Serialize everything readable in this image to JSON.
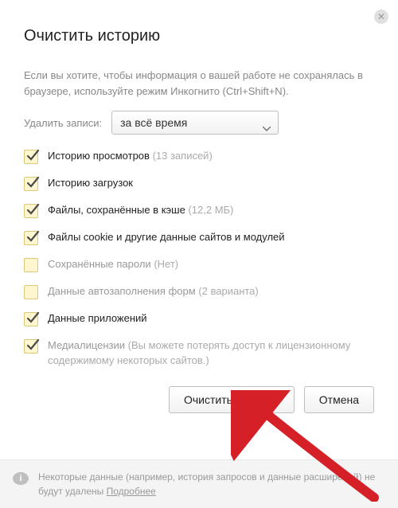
{
  "title": "Очистить историю",
  "hint_text": "Если вы хотите, чтобы информация о вашей работе не сохранялась в браузере, используйте режим Инкогнито (Ctrl+Shift+N).",
  "time_label": "Удалить записи:",
  "time_value": "за всё время",
  "options": [
    {
      "checked": true,
      "label": "Историю просмотров",
      "extra": "(13 записей)",
      "dim": false
    },
    {
      "checked": true,
      "label": "Историю загрузок",
      "extra": "",
      "dim": false
    },
    {
      "checked": true,
      "label": "Файлы, сохранённые в кэше",
      "extra": "(12,2 МБ)",
      "dim": false
    },
    {
      "checked": true,
      "label": "Файлы cookie и другие данные сайтов и модулей",
      "extra": "",
      "dim": false
    },
    {
      "checked": false,
      "label": "Сохранённые пароли",
      "extra": "(Нет)",
      "dim": true
    },
    {
      "checked": false,
      "label": "Данные автозаполнения форм",
      "extra": "(2 варианта)",
      "dim": true
    },
    {
      "checked": true,
      "label": "Данные приложений",
      "extra": "",
      "dim": false
    },
    {
      "checked": true,
      "label": "Медиалицензии",
      "extra": "(Вы можете потерять доступ к лицензионному содержимому некоторых сайтов.)",
      "dim": true
    }
  ],
  "btn_clear": "Очистить историю",
  "btn_cancel": "Отмена",
  "footer_text": "Некоторые данные (например, история запросов и данные расширений) не будут удалены ",
  "footer_link": "Подробнее"
}
